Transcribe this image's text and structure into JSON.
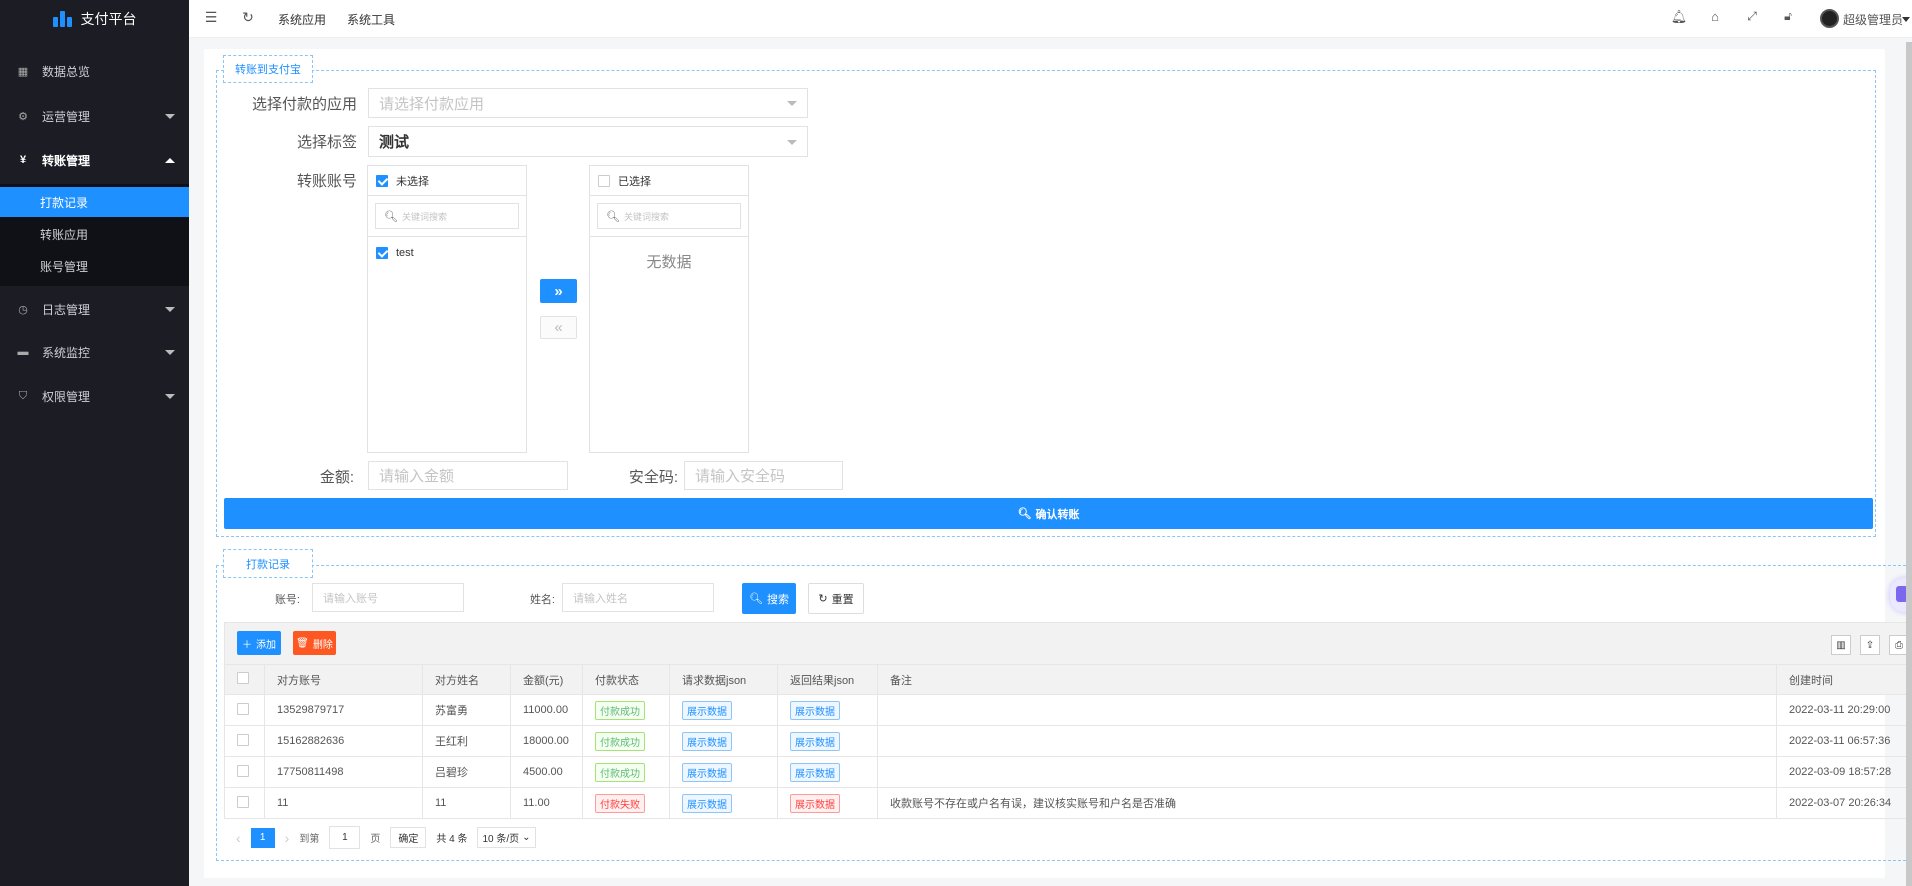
{
  "app": {
    "title": "支付平台"
  },
  "topbar": {
    "links": [
      "系统应用",
      "系统工具"
    ],
    "user": "超级管理员"
  },
  "sidebar": {
    "items": [
      {
        "label": "数据总览",
        "icon": "dashboard-icon"
      },
      {
        "label": "运营管理",
        "icon": "settings-icon"
      },
      {
        "label": "转账管理",
        "icon": "yen-icon"
      },
      {
        "label": "日志管理",
        "icon": "clock-icon"
      },
      {
        "label": "系统监控",
        "icon": "monitor-icon"
      },
      {
        "label": "权限管理",
        "icon": "shield-icon"
      }
    ],
    "sub_items": [
      "打款记录",
      "转账应用",
      "账号管理"
    ]
  },
  "transfer": {
    "legend": "转账到支付宝",
    "app_label": "选择付款的应用",
    "app_placeholder": "请选择付款应用",
    "tag_label": "选择标签",
    "tag_value": "测试",
    "account_label": "转账账号",
    "left_title": "未选择",
    "right_title": "已选择",
    "search_placeholder": "关键词搜索",
    "left_items": [
      "test"
    ],
    "right_empty": "无数据",
    "amount_label": "金额:",
    "amount_placeholder": "请输入金额",
    "code_label": "安全码:",
    "code_placeholder": "请输入安全码",
    "confirm": "确认转账"
  },
  "records": {
    "legend": "打款记录",
    "account_label": "账号:",
    "account_placeholder": "请输入账号",
    "name_label": "姓名:",
    "name_placeholder": "请输入姓名",
    "search": "搜索",
    "reset": "重置",
    "add": "添加",
    "delete": "删除",
    "columns": [
      "对方账号",
      "对方姓名",
      "金额(元)",
      "付款状态",
      "请求数据json",
      "返回结果json",
      "备注",
      "创建时间"
    ],
    "rows": [
      {
        "account": "13529879717",
        "name": "苏富勇",
        "amount": "11000.00",
        "status": "付款成功",
        "status_type": "green",
        "req": "展示数据",
        "resp": "展示数据",
        "resp_type": "blue",
        "remark": "",
        "time": "2022-03-11 20:29:00"
      },
      {
        "account": "15162882636",
        "name": "王红利",
        "amount": "18000.00",
        "status": "付款成功",
        "status_type": "green",
        "req": "展示数据",
        "resp": "展示数据",
        "resp_type": "blue",
        "remark": "",
        "time": "2022-03-11 06:57:36"
      },
      {
        "account": "17750811498",
        "name": "吕碧珍",
        "amount": "4500.00",
        "status": "付款成功",
        "status_type": "green",
        "req": "展示数据",
        "resp": "展示数据",
        "resp_type": "blue",
        "remark": "",
        "time": "2022-03-09 18:57:28"
      },
      {
        "account": "11",
        "name": "11",
        "amount": "11.00",
        "status": "付款失败",
        "status_type": "red",
        "req": "展示数据",
        "resp": "展示数据",
        "resp_type": "red",
        "remark": "收款账号不存在或户名有误，建议核实账号和户名是否准确",
        "time": "2022-03-07 20:26:34"
      }
    ],
    "pagination": {
      "current": "1",
      "goto_prefix": "到第",
      "goto_value": "1",
      "goto_suffix": "页",
      "confirm": "确定",
      "total": "共 4 条",
      "page_size": "10 条/页"
    }
  },
  "colors": {
    "primary": "#1e90ff",
    "danger": "#ff5722",
    "sidebar": "#1b1c24"
  }
}
